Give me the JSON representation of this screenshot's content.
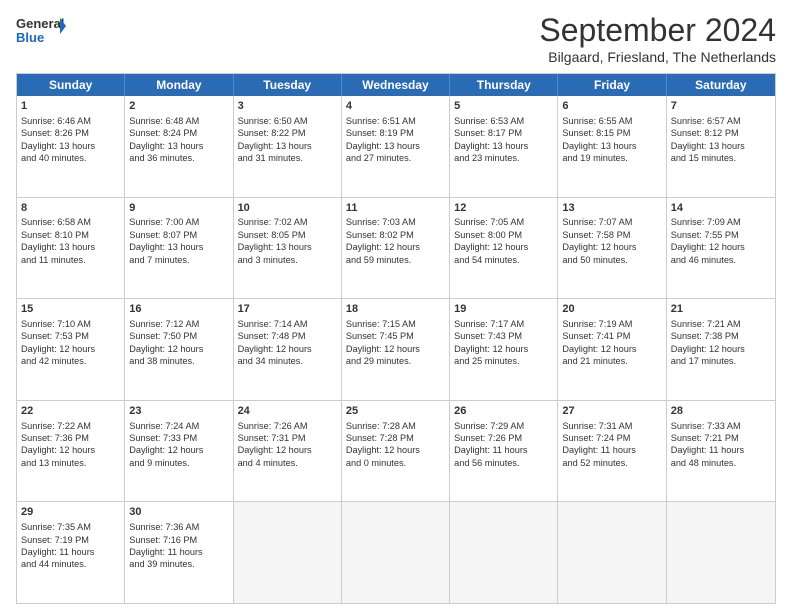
{
  "logo": {
    "line1": "General",
    "line2": "Blue"
  },
  "title": "September 2024",
  "subtitle": "Bilgaard, Friesland, The Netherlands",
  "headers": [
    "Sunday",
    "Monday",
    "Tuesday",
    "Wednesday",
    "Thursday",
    "Friday",
    "Saturday"
  ],
  "rows": [
    [
      {
        "day": "1",
        "lines": [
          "Sunrise: 6:46 AM",
          "Sunset: 8:26 PM",
          "Daylight: 13 hours",
          "and 40 minutes."
        ]
      },
      {
        "day": "2",
        "lines": [
          "Sunrise: 6:48 AM",
          "Sunset: 8:24 PM",
          "Daylight: 13 hours",
          "and 36 minutes."
        ]
      },
      {
        "day": "3",
        "lines": [
          "Sunrise: 6:50 AM",
          "Sunset: 8:22 PM",
          "Daylight: 13 hours",
          "and 31 minutes."
        ]
      },
      {
        "day": "4",
        "lines": [
          "Sunrise: 6:51 AM",
          "Sunset: 8:19 PM",
          "Daylight: 13 hours",
          "and 27 minutes."
        ]
      },
      {
        "day": "5",
        "lines": [
          "Sunrise: 6:53 AM",
          "Sunset: 8:17 PM",
          "Daylight: 13 hours",
          "and 23 minutes."
        ]
      },
      {
        "day": "6",
        "lines": [
          "Sunrise: 6:55 AM",
          "Sunset: 8:15 PM",
          "Daylight: 13 hours",
          "and 19 minutes."
        ]
      },
      {
        "day": "7",
        "lines": [
          "Sunrise: 6:57 AM",
          "Sunset: 8:12 PM",
          "Daylight: 13 hours",
          "and 15 minutes."
        ]
      }
    ],
    [
      {
        "day": "8",
        "lines": [
          "Sunrise: 6:58 AM",
          "Sunset: 8:10 PM",
          "Daylight: 13 hours",
          "and 11 minutes."
        ]
      },
      {
        "day": "9",
        "lines": [
          "Sunrise: 7:00 AM",
          "Sunset: 8:07 PM",
          "Daylight: 13 hours",
          "and 7 minutes."
        ]
      },
      {
        "day": "10",
        "lines": [
          "Sunrise: 7:02 AM",
          "Sunset: 8:05 PM",
          "Daylight: 13 hours",
          "and 3 minutes."
        ]
      },
      {
        "day": "11",
        "lines": [
          "Sunrise: 7:03 AM",
          "Sunset: 8:02 PM",
          "Daylight: 12 hours",
          "and 59 minutes."
        ]
      },
      {
        "day": "12",
        "lines": [
          "Sunrise: 7:05 AM",
          "Sunset: 8:00 PM",
          "Daylight: 12 hours",
          "and 54 minutes."
        ]
      },
      {
        "day": "13",
        "lines": [
          "Sunrise: 7:07 AM",
          "Sunset: 7:58 PM",
          "Daylight: 12 hours",
          "and 50 minutes."
        ]
      },
      {
        "day": "14",
        "lines": [
          "Sunrise: 7:09 AM",
          "Sunset: 7:55 PM",
          "Daylight: 12 hours",
          "and 46 minutes."
        ]
      }
    ],
    [
      {
        "day": "15",
        "lines": [
          "Sunrise: 7:10 AM",
          "Sunset: 7:53 PM",
          "Daylight: 12 hours",
          "and 42 minutes."
        ]
      },
      {
        "day": "16",
        "lines": [
          "Sunrise: 7:12 AM",
          "Sunset: 7:50 PM",
          "Daylight: 12 hours",
          "and 38 minutes."
        ]
      },
      {
        "day": "17",
        "lines": [
          "Sunrise: 7:14 AM",
          "Sunset: 7:48 PM",
          "Daylight: 12 hours",
          "and 34 minutes."
        ]
      },
      {
        "day": "18",
        "lines": [
          "Sunrise: 7:15 AM",
          "Sunset: 7:45 PM",
          "Daylight: 12 hours",
          "and 29 minutes."
        ]
      },
      {
        "day": "19",
        "lines": [
          "Sunrise: 7:17 AM",
          "Sunset: 7:43 PM",
          "Daylight: 12 hours",
          "and 25 minutes."
        ]
      },
      {
        "day": "20",
        "lines": [
          "Sunrise: 7:19 AM",
          "Sunset: 7:41 PM",
          "Daylight: 12 hours",
          "and 21 minutes."
        ]
      },
      {
        "day": "21",
        "lines": [
          "Sunrise: 7:21 AM",
          "Sunset: 7:38 PM",
          "Daylight: 12 hours",
          "and 17 minutes."
        ]
      }
    ],
    [
      {
        "day": "22",
        "lines": [
          "Sunrise: 7:22 AM",
          "Sunset: 7:36 PM",
          "Daylight: 12 hours",
          "and 13 minutes."
        ]
      },
      {
        "day": "23",
        "lines": [
          "Sunrise: 7:24 AM",
          "Sunset: 7:33 PM",
          "Daylight: 12 hours",
          "and 9 minutes."
        ]
      },
      {
        "day": "24",
        "lines": [
          "Sunrise: 7:26 AM",
          "Sunset: 7:31 PM",
          "Daylight: 12 hours",
          "and 4 minutes."
        ]
      },
      {
        "day": "25",
        "lines": [
          "Sunrise: 7:28 AM",
          "Sunset: 7:28 PM",
          "Daylight: 12 hours",
          "and 0 minutes."
        ]
      },
      {
        "day": "26",
        "lines": [
          "Sunrise: 7:29 AM",
          "Sunset: 7:26 PM",
          "Daylight: 11 hours",
          "and 56 minutes."
        ]
      },
      {
        "day": "27",
        "lines": [
          "Sunrise: 7:31 AM",
          "Sunset: 7:24 PM",
          "Daylight: 11 hours",
          "and 52 minutes."
        ]
      },
      {
        "day": "28",
        "lines": [
          "Sunrise: 7:33 AM",
          "Sunset: 7:21 PM",
          "Daylight: 11 hours",
          "and 48 minutes."
        ]
      }
    ],
    [
      {
        "day": "29",
        "lines": [
          "Sunrise: 7:35 AM",
          "Sunset: 7:19 PM",
          "Daylight: 11 hours",
          "and 44 minutes."
        ]
      },
      {
        "day": "30",
        "lines": [
          "Sunrise: 7:36 AM",
          "Sunset: 7:16 PM",
          "Daylight: 11 hours",
          "and 39 minutes."
        ]
      },
      {
        "day": "",
        "lines": []
      },
      {
        "day": "",
        "lines": []
      },
      {
        "day": "",
        "lines": []
      },
      {
        "day": "",
        "lines": []
      },
      {
        "day": "",
        "lines": []
      }
    ]
  ]
}
